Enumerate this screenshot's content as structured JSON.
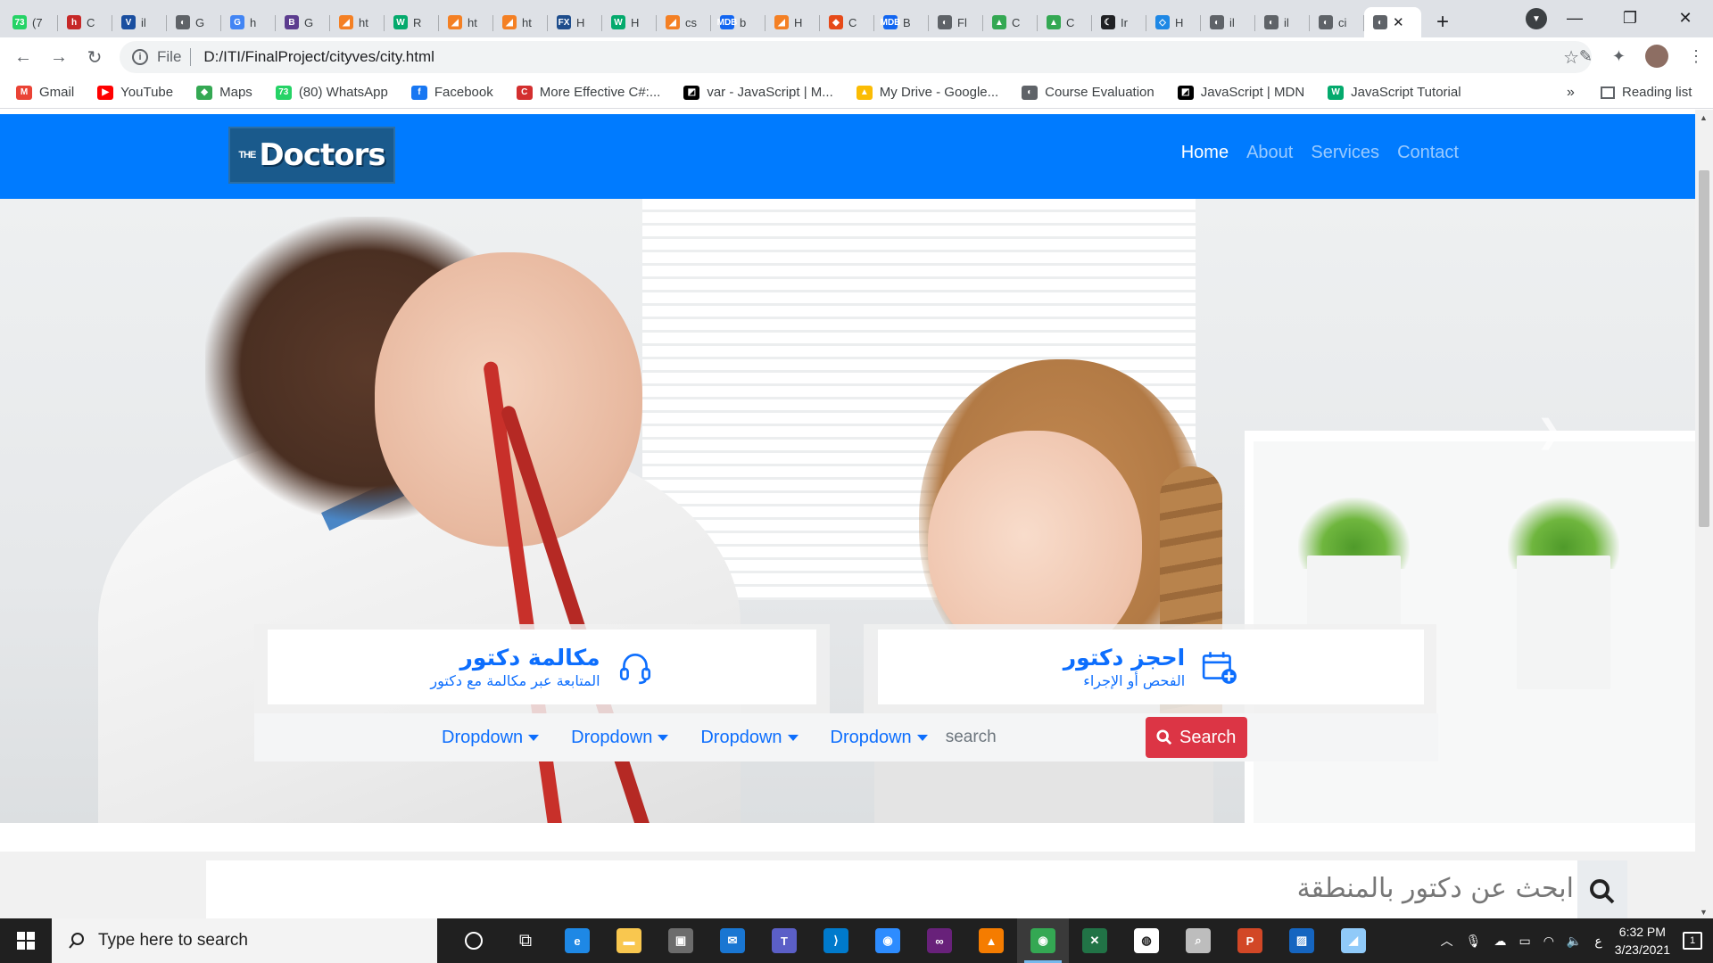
{
  "browser": {
    "tabs": [
      {
        "label": "(7",
        "fav_text": "73",
        "color": "#25d366"
      },
      {
        "label": "C",
        "fav_text": "h",
        "color": "#c62828"
      },
      {
        "label": "il",
        "fav_text": "V",
        "color": "#1a4fa0"
      },
      {
        "label": "G",
        "fav_text": "◐",
        "color": "#5f6368"
      },
      {
        "label": "h",
        "fav_text": "G",
        "color": "#4285f4"
      },
      {
        "label": "G",
        "fav_text": "B",
        "color": "#5c3d8f"
      },
      {
        "label": "ht",
        "fav_text": "◢",
        "color": "#f48024"
      },
      {
        "label": "R",
        "fav_text": "W",
        "color": "#04aa6d"
      },
      {
        "label": "ht",
        "fav_text": "◢",
        "color": "#f48024"
      },
      {
        "label": "ht",
        "fav_text": "◢",
        "color": "#f48024"
      },
      {
        "label": "H",
        "fav_text": "FX",
        "color": "#1e4d8c"
      },
      {
        "label": "H",
        "fav_text": "W",
        "color": "#04aa6d"
      },
      {
        "label": "cs",
        "fav_text": "◢",
        "color": "#f48024"
      },
      {
        "label": "b",
        "fav_text": "MDB",
        "color": "#1266f1"
      },
      {
        "label": "H",
        "fav_text": "◢",
        "color": "#f48024"
      },
      {
        "label": "C",
        "fav_text": "◆",
        "color": "#e64a19"
      },
      {
        "label": "B",
        "fav_text": "MDB",
        "color": "#1266f1"
      },
      {
        "label": "Fl",
        "fav_text": "◐",
        "color": "#5f6368"
      },
      {
        "label": "C",
        "fav_text": "▲",
        "color": "#34a853"
      },
      {
        "label": "C",
        "fav_text": "▲",
        "color": "#34a853"
      },
      {
        "label": "Ir",
        "fav_text": "☾",
        "color": "#202124"
      },
      {
        "label": "H",
        "fav_text": "◇",
        "color": "#1e88e5"
      },
      {
        "label": "il",
        "fav_text": "◐",
        "color": "#5f6368"
      },
      {
        "label": "il",
        "fav_text": "◐",
        "color": "#5f6368"
      },
      {
        "label": "ci",
        "fav_text": "◐",
        "color": "#5f6368"
      }
    ],
    "active_tab_fav": "◐",
    "url_scheme": "File",
    "url": "D:/ITI/FinalProject/cityves/city.html",
    "bookmarks": [
      {
        "label": "Gmail",
        "ic": "M",
        "color": "#ea4335"
      },
      {
        "label": "YouTube",
        "ic": "▶",
        "color": "#ff0000"
      },
      {
        "label": "Maps",
        "ic": "◆",
        "color": "#34a853"
      },
      {
        "label": "(80) WhatsApp",
        "ic": "73",
        "color": "#25d366"
      },
      {
        "label": "Facebook",
        "ic": "f",
        "color": "#1877f2"
      },
      {
        "label": "More Effective C#:...",
        "ic": "C",
        "color": "#d32f2f"
      },
      {
        "label": "var - JavaScript | M...",
        "ic": "◩",
        "color": "#000000"
      },
      {
        "label": "My Drive - Google...",
        "ic": "▲",
        "color": "#fbbc04"
      },
      {
        "label": "Course Evaluation",
        "ic": "◐",
        "color": "#5f6368"
      },
      {
        "label": "JavaScript | MDN",
        "ic": "◩",
        "color": "#000000"
      },
      {
        "label": "JavaScript Tutorial",
        "ic": "W",
        "color": "#04aa6d"
      }
    ],
    "bookmarks_more": "»",
    "reading_list": "Reading list"
  },
  "site": {
    "logo_the": "THE",
    "logo_name": "Doctors",
    "nav": [
      "Home",
      "About",
      "Services",
      "Contact"
    ],
    "brand_color": "#007bff",
    "card_call": {
      "title": "مكالمة دكتور",
      "subtitle": "المتابعة عبر مكالمة مع دكتور",
      "icon": "headset-icon"
    },
    "card_book": {
      "title": "احجز دكتور",
      "subtitle": "الفحص أو الإجراء",
      "icon": "calendar-plus-icon"
    },
    "dropdowns": [
      "Dropdown",
      "Dropdown",
      "Dropdown",
      "Dropdown"
    ],
    "search_placeholder": "search",
    "search_button": "Search",
    "area_search_placeholder": "ابحث عن دكتور بالمنطقة"
  },
  "taskbar": {
    "search_placeholder": "Type here to search",
    "time": "6:32 PM",
    "date": "3/23/2021",
    "lang": "ع",
    "notifications": "1",
    "apps": [
      {
        "name": "edge",
        "ic": "e",
        "color": "#1e88e5"
      },
      {
        "name": "file-explorer",
        "ic": "▬",
        "color": "#f9c74f"
      },
      {
        "name": "store",
        "ic": "▣",
        "color": "#6c6c6c"
      },
      {
        "name": "mail",
        "ic": "✉",
        "color": "#1976d2"
      },
      {
        "name": "teams",
        "ic": "T",
        "color": "#5b5fc7"
      },
      {
        "name": "vs-code",
        "ic": "⟩",
        "color": "#007acc"
      },
      {
        "name": "zoom",
        "ic": "◉",
        "color": "#2d8cff"
      },
      {
        "name": "visual-studio",
        "ic": "∞",
        "color": "#68217a"
      },
      {
        "name": "vlc",
        "ic": "▲",
        "color": "#f57c00"
      },
      {
        "name": "chrome",
        "ic": "◉",
        "color": "#34a853"
      },
      {
        "name": "excel-tool",
        "ic": "✕",
        "color": "#217346"
      },
      {
        "name": "camera-app",
        "ic": "◍",
        "color": "#ffffff"
      },
      {
        "name": "search-app",
        "ic": "⌕",
        "color": "#bdbdbd"
      },
      {
        "name": "powerpoint",
        "ic": "P",
        "color": "#d24726"
      },
      {
        "name": "photos",
        "ic": "▨",
        "color": "#1565c0"
      },
      {
        "name": "notes",
        "ic": "◢",
        "color": "#90caf9"
      }
    ]
  }
}
